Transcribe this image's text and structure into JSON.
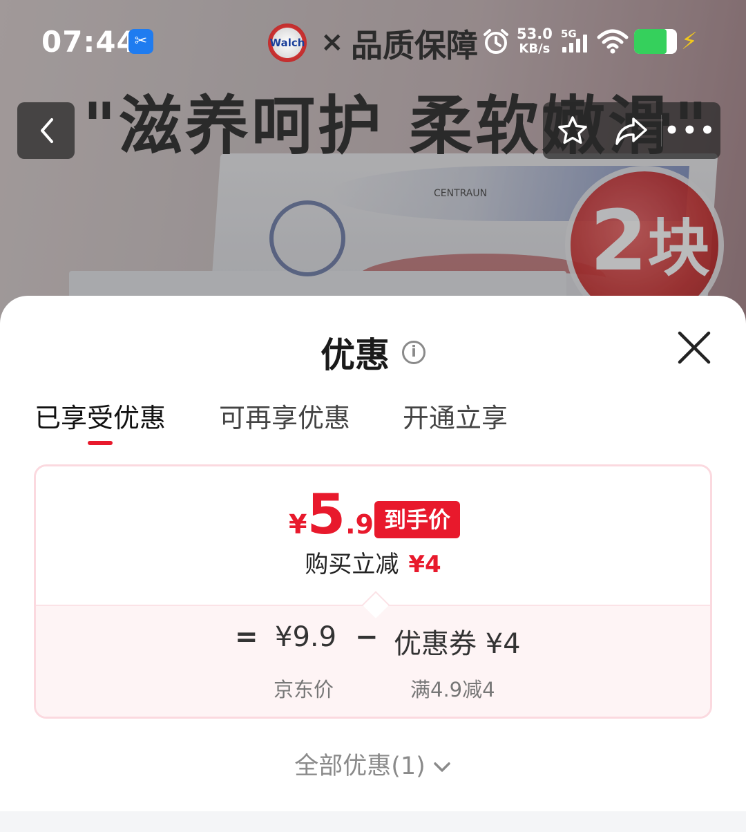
{
  "status_bar": {
    "time": "07:44",
    "app_badge_icon": "scissors-icon",
    "brand_logo_text": "Walch",
    "brand_x": "×",
    "brand_text": "品质保障",
    "net_speed_value": "53.0",
    "net_speed_unit": "KB/s",
    "network_type": "5G",
    "battery_level": 0.75,
    "charging": true
  },
  "banner": {
    "headline": "\"滋养呵护 柔软嫩滑\"",
    "box_brand": "CENTRAUN",
    "badge_number": "2",
    "badge_unit": "块"
  },
  "nav": {
    "back_icon": "chevron-left-icon",
    "favorite_icon": "star-icon",
    "share_icon": "share-icon",
    "more_icon": "more-dots-icon",
    "more_label": "•••"
  },
  "sheet": {
    "title": "优惠",
    "info_icon_label": "i",
    "tabs": [
      {
        "label": "已享受优惠",
        "active": true
      },
      {
        "label": "可再享优惠",
        "active": false
      },
      {
        "label": "开通立享",
        "active": false
      }
    ],
    "price": {
      "currency": "¥",
      "integer": "5",
      "decimal": ".9",
      "tag": "到手价",
      "discount_label": "购买立减",
      "discount_amount": "¥4"
    },
    "calc": {
      "equals": "=",
      "base_price": "¥9.9",
      "minus": "−",
      "coupon": "优惠券 ¥4",
      "base_label": "京东价",
      "coupon_rule": "满4.9减4"
    },
    "all_offers": "全部优惠(1)"
  },
  "colors": {
    "accent": "#e8192c",
    "card_border": "#fbd9df",
    "card_bottom_bg": "#fef4f5"
  }
}
